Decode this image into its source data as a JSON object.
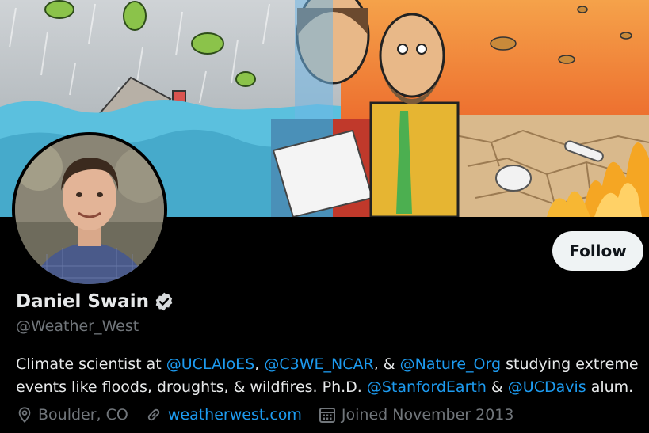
{
  "profile": {
    "name": "Daniel Swain",
    "handle": "@Weather_West",
    "follow_label": "Follow",
    "verified": true,
    "bio": {
      "text1": "Climate scientist at ",
      "mention1": "@UCLAIoES",
      "text2": ", ",
      "mention2": "@C3WE_NCAR",
      "text3": ", & ",
      "mention3": "@Nature_Org",
      "text4": " studying extreme events like floods, droughts, & wildfires. Ph.D. ",
      "mention4": "@StanfordEarth",
      "text5": " & ",
      "mention5": "@UCDavis",
      "text6": " alum."
    },
    "location": "Boulder, CO",
    "website": "weatherwest.com",
    "joined": "Joined November 2013"
  },
  "icons": {
    "location": "location-pin-icon",
    "link": "link-icon",
    "calendar": "calendar-icon",
    "verified": "verified-badge-icon"
  },
  "colors": {
    "background": "#000000",
    "text": "#e7e9ea",
    "secondary": "#71767b",
    "link": "#1d9bf0",
    "follow_bg": "#eff3f4"
  }
}
